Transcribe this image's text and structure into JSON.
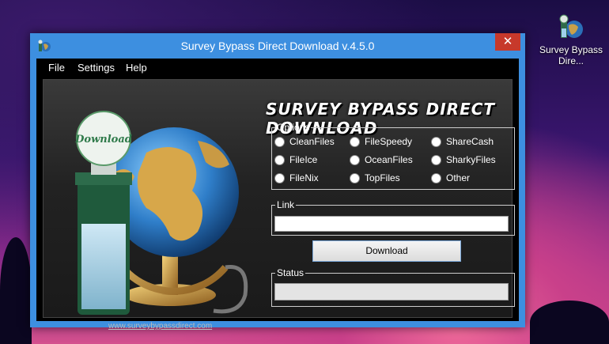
{
  "desktop": {
    "icon_label": "Survey Bypass Dire..."
  },
  "window": {
    "title": "Survey Bypass Direct Download v.4.5.0",
    "close_glyph": "✕"
  },
  "menu": [
    "File",
    "Settings",
    "Help"
  ],
  "heading": "Survey Bypass Direct Download",
  "logo": {
    "bottle_label": "Download",
    "url": "www.surveybypassdirect.com"
  },
  "options": {
    "legend": "Options",
    "items": [
      "CleanFiles",
      "FileSpeedy",
      "ShareCash",
      "FileIce",
      "OceanFiles",
      "SharkyFiles",
      "FileNix",
      "TopFiles",
      "Other"
    ]
  },
  "link": {
    "legend": "Link",
    "value": ""
  },
  "download_button": "Download",
  "status": {
    "legend": "Status",
    "value": ""
  },
  "colors": {
    "window_border": "#3d8fe0",
    "close_button": "#c7392b"
  }
}
